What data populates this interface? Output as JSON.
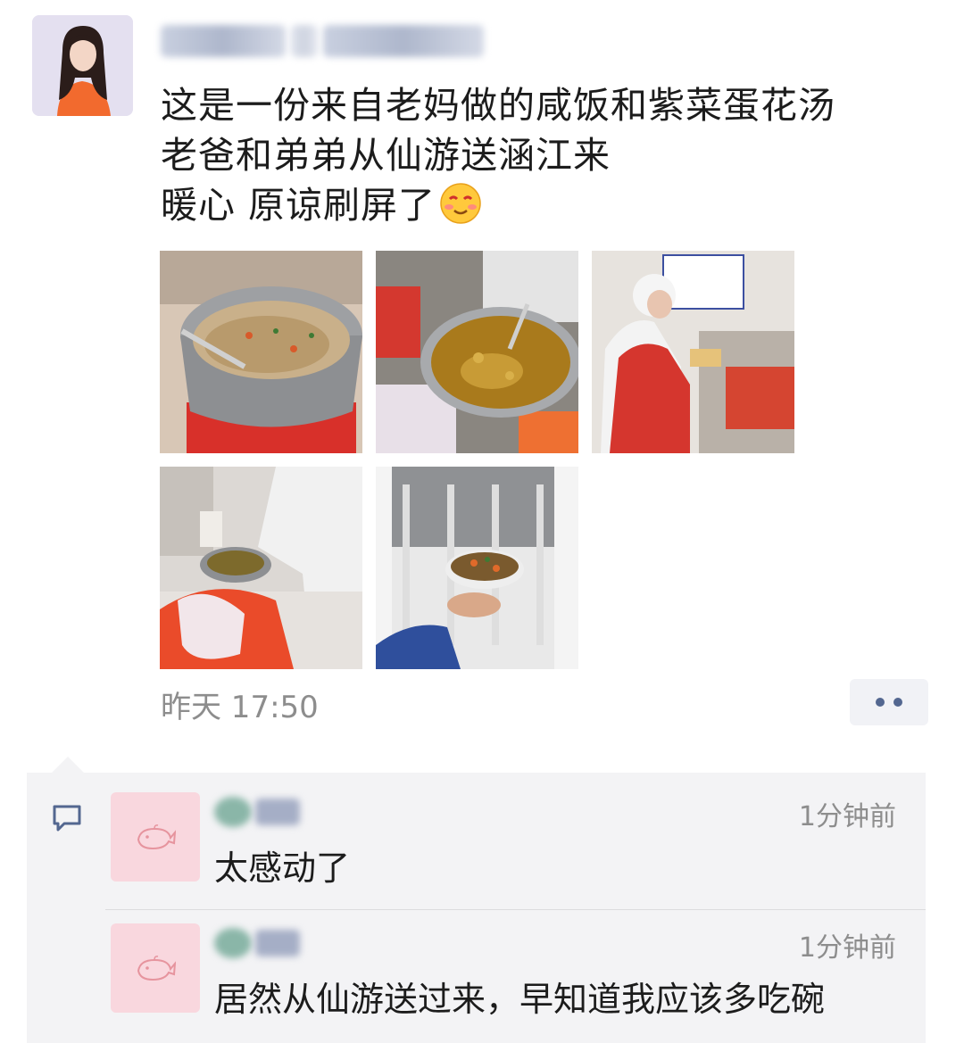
{
  "post": {
    "author_avatar": "avatar",
    "nickname_blurred": true,
    "lines": [
      "这是一份来自老妈做的咸饭和紫菜蛋花汤",
      "老爸和弟弟从仙游送涵江来",
      "暖心  原谅刷屏了"
    ],
    "emoji": "smiling-face-icon",
    "photos": [
      {
        "subject": "rice-pot"
      },
      {
        "subject": "soup-pot"
      },
      {
        "subject": "volunteer"
      },
      {
        "subject": "serving"
      },
      {
        "subject": "bowl-hand"
      }
    ],
    "timestamp": "昨天 17:50",
    "more_icon": "more-dots-icon"
  },
  "comments": {
    "icon": "comment-icon",
    "items": [
      {
        "avatar": "whale-icon",
        "time": "1分钟前",
        "text": "太感动了"
      },
      {
        "avatar": "whale-icon",
        "time": "1分钟前",
        "text": "居然从仙游送过来，早知道我应该多吃碗"
      }
    ]
  },
  "colors": {
    "text": "#1c1c1c",
    "meta": "#8d8d8d",
    "link": "#536790",
    "comment_bg": "#f3f3f5"
  }
}
